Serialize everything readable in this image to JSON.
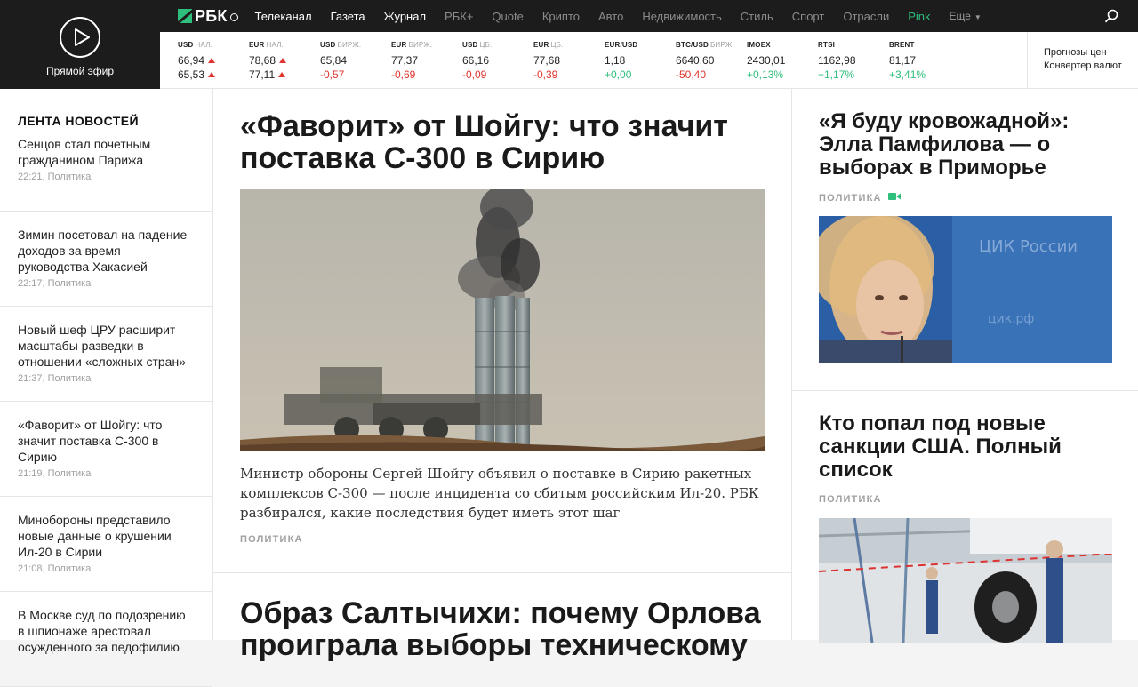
{
  "live": {
    "label": "Прямой эфир"
  },
  "logo": {
    "text": "РБК"
  },
  "nav": {
    "items": [
      {
        "label": "Телеканал",
        "style": "normal"
      },
      {
        "label": "Газета",
        "style": "normal"
      },
      {
        "label": "Журнал",
        "style": "normal"
      },
      {
        "label": "РБК+",
        "style": "dim"
      },
      {
        "label": "Quote",
        "style": "dim"
      },
      {
        "label": "Крипто",
        "style": "dim"
      },
      {
        "label": "Авто",
        "style": "dim"
      },
      {
        "label": "Недвижимость",
        "style": "dim"
      },
      {
        "label": "Стиль",
        "style": "dim"
      },
      {
        "label": "Спорт",
        "style": "dim"
      },
      {
        "label": "Отрасли",
        "style": "dim"
      },
      {
        "label": "Pink",
        "style": "pink"
      }
    ],
    "more_label": "Еще",
    "search_icon": "search-icon"
  },
  "ticker": {
    "items": [
      {
        "name": "USD",
        "sub": "НАЛ.",
        "v1": "66,94",
        "v2": "65,53",
        "v2_style": "plain",
        "arrows": true
      },
      {
        "name": "EUR",
        "sub": "НАЛ.",
        "v1": "78,68",
        "v2": "77,11",
        "v2_style": "plain",
        "arrows": true
      },
      {
        "name": "USD",
        "sub": "БИРЖ.",
        "v1": "65,84",
        "v2": "-0,57",
        "v2_style": "red",
        "arrows": false
      },
      {
        "name": "EUR",
        "sub": "БИРЖ.",
        "v1": "77,37",
        "v2": "-0,69",
        "v2_style": "red",
        "arrows": false
      },
      {
        "name": "USD",
        "sub": "ЦБ.",
        "v1": "66,16",
        "v2": "-0,09",
        "v2_style": "red",
        "arrows": false
      },
      {
        "name": "EUR",
        "sub": "ЦБ.",
        "v1": "77,68",
        "v2": "-0,39",
        "v2_style": "red",
        "arrows": false
      },
      {
        "name": "EUR/USD",
        "sub": "",
        "v1": "1,18",
        "v2": "+0,00",
        "v2_style": "green",
        "arrows": false
      },
      {
        "name": "BTC/USD",
        "sub": "БИРЖ.",
        "v1": "6640,60",
        "v2": "-50,40",
        "v2_style": "red",
        "arrows": false
      },
      {
        "name": "IMOEX",
        "sub": "",
        "v1": "2430,01",
        "v2": "+0,13%",
        "v2_style": "green",
        "arrows": false
      },
      {
        "name": "RTSI",
        "sub": "",
        "v1": "1162,98",
        "v2": "+1,17%",
        "v2_style": "green",
        "arrows": false
      },
      {
        "name": "BRENT",
        "sub": "",
        "v1": "81,17",
        "v2": "+3,41%",
        "v2_style": "green",
        "arrows": false
      }
    ],
    "links": [
      "Прогнозы цен",
      "Конвертер валют"
    ],
    "colors": {
      "up": "#2fbf7c",
      "down": "#e0342e"
    }
  },
  "feed": {
    "title": "ЛЕНТА НОВОСТЕЙ",
    "items": [
      {
        "text": "Сенцов стал почетным гражданином Парижа",
        "meta": "22:21, Политика"
      },
      {
        "text": "Зимин посетовал на падение доходов за время руководства Хакасией",
        "meta": "22:17, Политика"
      },
      {
        "text": "Новый шеф ЦРУ расширит масштабы разведки в отношении «сложных стран»",
        "meta": "21:37, Политика"
      },
      {
        "text": "«Фаворит» от Шойгу: что значит поставка С-300 в Сирию",
        "meta": "21:19, Политика"
      },
      {
        "text": "Минобороны представило новые данные о крушении Ил-20 в Сирии",
        "meta": "21:08, Политика"
      },
      {
        "text": "В Москве суд по подозрению в шпионаже арестовал осужденного за педофилию",
        "meta": ""
      }
    ]
  },
  "main": {
    "title": "«Фаворит» от Шойгу: что значит поставка С-300 в Сирию",
    "lead": "Министр обороны Сергей Шойгу объявил о поставке в Сирию ракетных комплексов С-300 — после инцидента со сбитым российским Ил-20. РБК разбирался, какие последствия будет иметь этот шаг",
    "tag": "ПОЛИТИКА",
    "next_title": "Образ Салтычихи: почему Орлова проиграла выборы техническому"
  },
  "right": {
    "items": [
      {
        "title": "«Я буду кровожадной»: Элла Памфилова — о выборах в Приморье",
        "tag": "ПОЛИТИКА",
        "video": true
      },
      {
        "title": "Кто попал под новые санкции США. Полный список",
        "tag": "ПОЛИТИКА",
        "video": false
      }
    ]
  },
  "accent_color": "#2fbf7c"
}
